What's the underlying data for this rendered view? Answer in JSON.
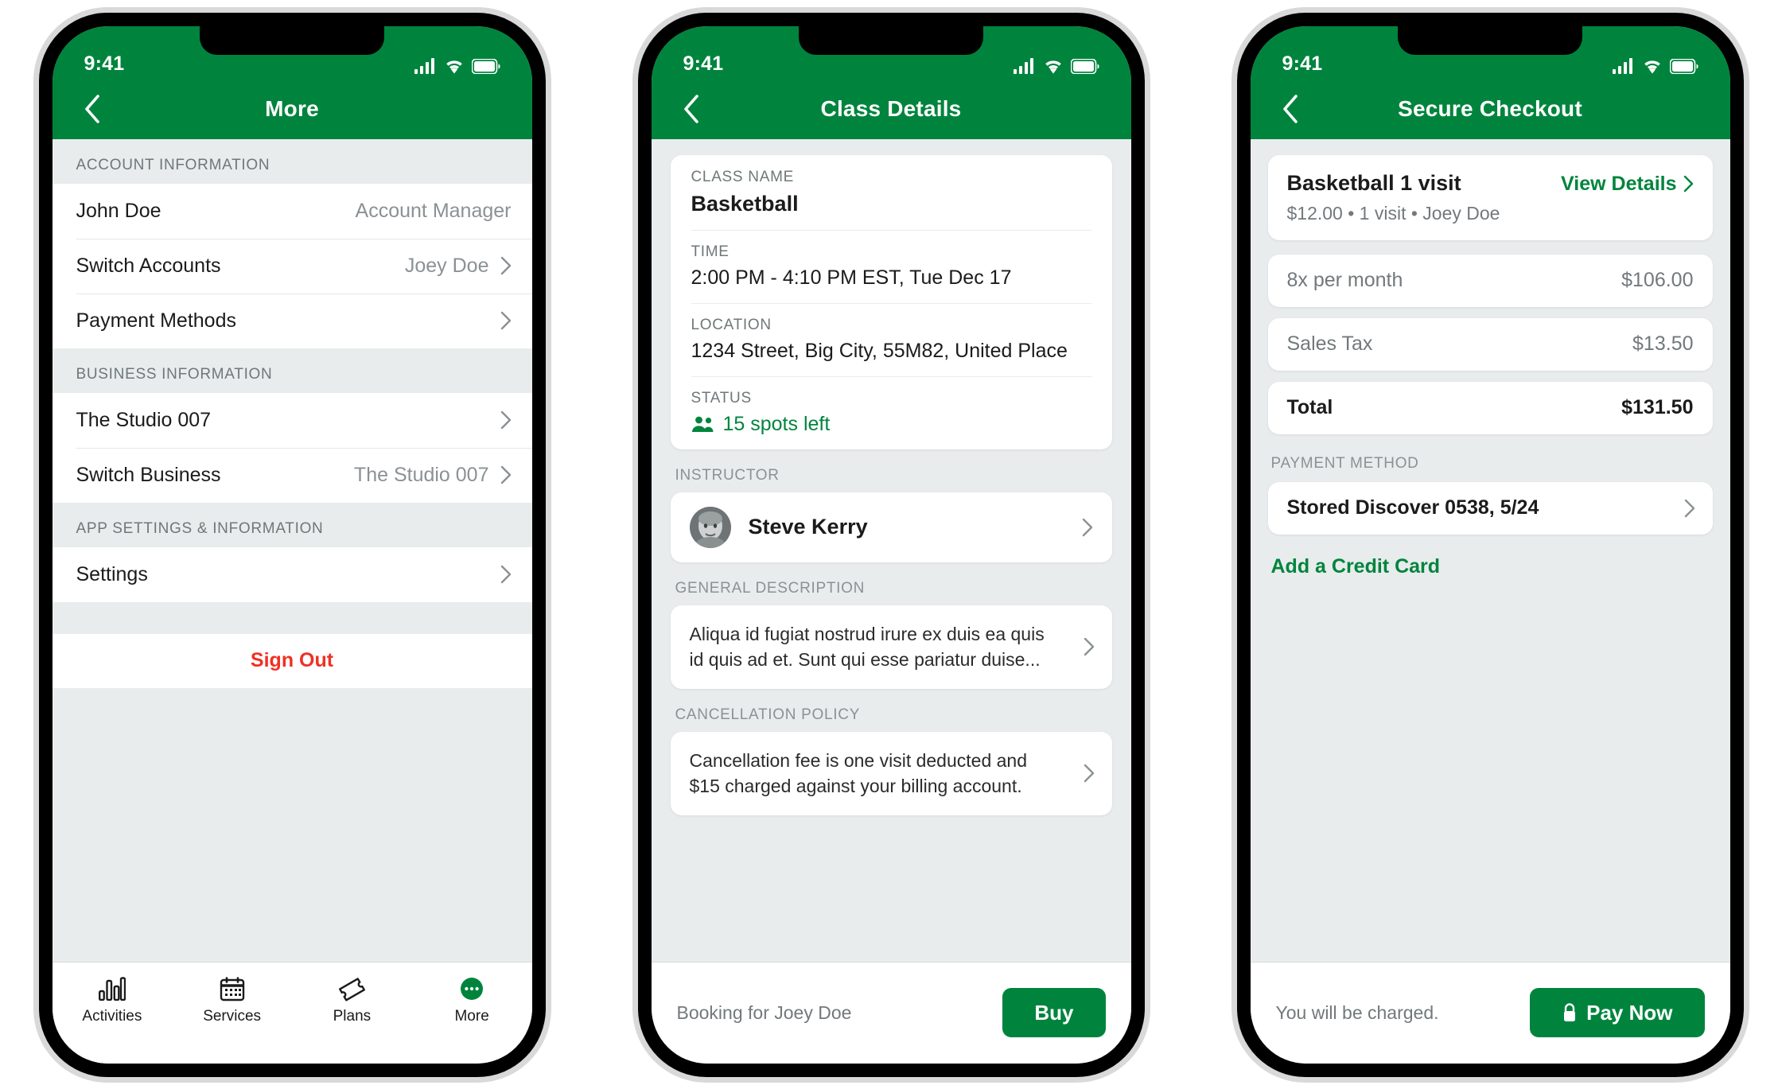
{
  "colors": {
    "brand_green": "#00843D",
    "screen_bg": "#E8ECED",
    "card_white": "#FFFFFF",
    "muted_text": "#72797B",
    "label_grey": "#8B9194",
    "danger_red": "#EF3124"
  },
  "status_bar": {
    "time": "9:41",
    "cellular_icon": "signal-bars-icon",
    "wifi_icon": "wifi-icon",
    "battery_icon": "battery-icon"
  },
  "screen_more": {
    "nav": {
      "back_icon": "back-chevron-icon",
      "title": "More"
    },
    "sections": [
      {
        "header": "ACCOUNT INFORMATION",
        "rows": [
          {
            "label": "John Doe",
            "value": "Account Manager",
            "chevron": false
          },
          {
            "label": "Switch Accounts",
            "value": "Joey Doe",
            "chevron": true
          },
          {
            "label": "Payment Methods",
            "value": "",
            "chevron": true
          }
        ]
      },
      {
        "header": "BUSINESS INFORMATION",
        "rows": [
          {
            "label": "The Studio 007",
            "value": "",
            "chevron": true
          },
          {
            "label": "Switch Business",
            "value": "The Studio 007",
            "chevron": true
          }
        ]
      },
      {
        "header": "APP SETTINGS & INFORMATION",
        "rows": [
          {
            "label": "Settings",
            "value": "",
            "chevron": true
          }
        ]
      }
    ],
    "sign_out": "Sign Out",
    "tabbar": [
      {
        "label": "Activities",
        "icon": "bar-chart-icon",
        "active": false
      },
      {
        "label": "Services",
        "icon": "calendar-icon",
        "active": false
      },
      {
        "label": "Plans",
        "icon": "ticket-icon",
        "active": false
      },
      {
        "label": "More",
        "icon": "more-dots-icon",
        "active": true
      }
    ]
  },
  "screen_class_details": {
    "nav": {
      "back_icon": "back-chevron-icon",
      "title": "Class Details"
    },
    "fields": [
      {
        "label": "CLASS NAME",
        "value": "Basketball",
        "bold": true
      },
      {
        "label": "TIME",
        "value": "2:00 PM - 4:10 PM EST, Tue Dec 17",
        "bold": false
      },
      {
        "label": "LOCATION",
        "value": "1234 Street, Big City, 55M82, United Place",
        "bold": false
      }
    ],
    "status": {
      "label": "STATUS",
      "icon": "people-icon",
      "value": "15 spots left"
    },
    "instructor": {
      "section_label": "INSTRUCTOR",
      "name": "Steve Kerry",
      "avatar": "instructor-avatar",
      "chevron": "chevron-right-icon"
    },
    "description": {
      "section_label": "GENERAL DESCRIPTION",
      "text": "Aliqua id fugiat nostrud irure ex duis ea quis id quis ad et. Sunt qui esse pariatur duise..."
    },
    "cancellation": {
      "section_label": "CANCELLATION POLICY",
      "text": "Cancellation fee is one visit deducted and $15 charged against your billing account."
    },
    "footer": {
      "note": "Booking for Joey Doe",
      "cta": "Buy"
    }
  },
  "screen_checkout": {
    "nav": {
      "back_icon": "back-chevron-icon",
      "title": "Secure Checkout"
    },
    "summary": {
      "title": "Basketball 1 visit",
      "link": "View Details",
      "link_icon": "chevron-right-icon",
      "subtitle": "$12.00 • 1 visit • Joey Doe"
    },
    "lines": [
      {
        "label": "8x per month",
        "amount": "$106.00",
        "total": false
      },
      {
        "label": "Sales Tax",
        "amount": "$13.50",
        "total": false
      },
      {
        "label": "Total",
        "amount": "$131.50",
        "total": true
      }
    ],
    "payment": {
      "header": "PAYMENT METHOD",
      "method": "Stored Discover 0538, 5/24",
      "chevron": "chevron-right-icon",
      "add_card": "Add a Credit Card"
    },
    "footer": {
      "note": "You will be charged.",
      "cta": "Pay Now",
      "cta_icon": "lock-icon"
    }
  }
}
